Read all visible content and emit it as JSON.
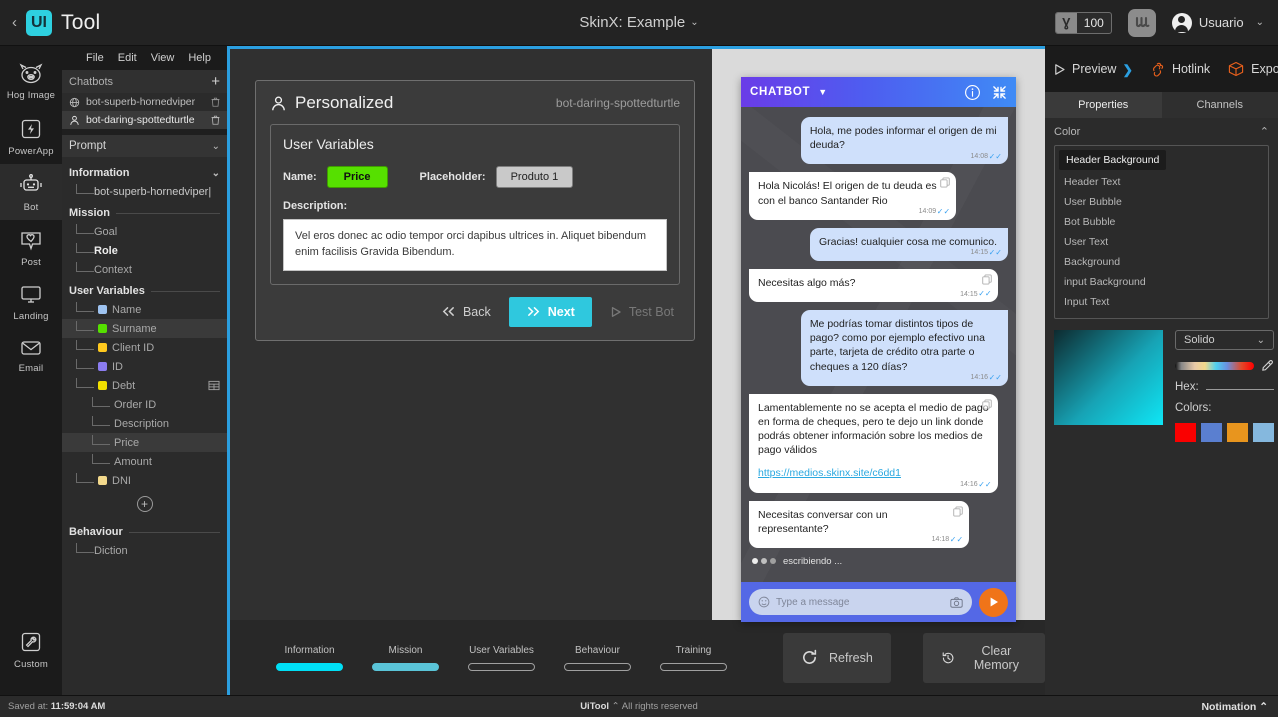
{
  "topbar": {
    "back_icon": "chevron-left-icon",
    "logo_mark": "UI",
    "logo_text": "Tool",
    "project_title": "SkinX: Example",
    "project_caret": "⌄",
    "coin_symbol": "Ɣ",
    "coin_value": "100",
    "grid_icon": "grid-icon",
    "user_name": "Usuario",
    "user_caret": "⌄"
  },
  "rail": {
    "items": [
      {
        "label": "Hog Image",
        "icon": "hog-icon",
        "active": false
      },
      {
        "label": "PowerApp",
        "icon": "bolt-icon",
        "active": false
      },
      {
        "label": "Bot",
        "icon": "robot-icon",
        "active": true
      },
      {
        "label": "Post",
        "icon": "heart-chat-icon",
        "active": false
      },
      {
        "label": "Landing",
        "icon": "monitor-icon",
        "active": false
      },
      {
        "label": "Email",
        "icon": "envelope-icon",
        "active": false
      }
    ],
    "bottom": {
      "label": "Custom",
      "icon": "wrench-icon"
    }
  },
  "menubar": {
    "items": [
      "File",
      "Edit",
      "View",
      "Help"
    ]
  },
  "chatbots": {
    "header": "Chatbots",
    "add_icon": "plus-icon",
    "items": [
      {
        "name": "bot-superb-hornedviper",
        "icon": "globe-icon",
        "selected": false
      },
      {
        "name": "bot-daring-spottedturtle",
        "icon": "person-icon",
        "selected": true
      }
    ]
  },
  "prompt_group": {
    "label": "Prompt",
    "caret": "⌄"
  },
  "tree": {
    "sections": [
      {
        "title": "Information",
        "caret": "⌄",
        "nodes": [
          {
            "label": "bot-superb-hornedviper|",
            "swatch": null,
            "style": "lit",
            "selected": false,
            "deep": false
          }
        ]
      },
      {
        "title": "Mission",
        "caret": "",
        "nodes": [
          {
            "label": "Goal",
            "swatch": null,
            "style": "dim",
            "selected": false,
            "deep": false
          },
          {
            "label": "Role",
            "swatch": null,
            "style": "strong",
            "selected": false,
            "deep": false
          },
          {
            "label": "Context",
            "swatch": null,
            "style": "dim",
            "selected": false,
            "deep": false
          }
        ]
      },
      {
        "title": "User Variables",
        "caret": "",
        "nodes": [
          {
            "label": "Name",
            "swatch": "#9ec3f0",
            "style": "dim",
            "selected": false,
            "deep": false
          },
          {
            "label": "Surname",
            "swatch": "#55e000",
            "style": "dim",
            "selected": true,
            "deep": false
          },
          {
            "label": "Client ID",
            "swatch": "#ffc91e",
            "style": "dim",
            "selected": false,
            "deep": false
          },
          {
            "label": "ID",
            "swatch": "#8b7cf0",
            "style": "dim",
            "selected": false,
            "deep": false
          },
          {
            "label": "Debt",
            "swatch": "#f2e000",
            "style": "dim",
            "selected": false,
            "deep": false,
            "table_icon": "table-icon"
          },
          {
            "label": "Order ID",
            "swatch": null,
            "style": "dim",
            "selected": false,
            "deep": true
          },
          {
            "label": "Description",
            "swatch": null,
            "style": "dim",
            "selected": false,
            "deep": true
          },
          {
            "label": "Price",
            "swatch": null,
            "style": "dim",
            "selected": true,
            "deep": true
          },
          {
            "label": "Amount",
            "swatch": null,
            "style": "dim",
            "selected": false,
            "deep": true
          },
          {
            "label": "DNI",
            "swatch": "#f3d98c",
            "style": "dim",
            "selected": false,
            "deep": false
          }
        ],
        "add_icon": "circle-plus-icon"
      },
      {
        "title": "Behaviour",
        "caret": "",
        "nodes": [
          {
            "label": "Diction",
            "swatch": null,
            "style": "dim",
            "selected": false,
            "deep": false
          }
        ]
      }
    ]
  },
  "modal": {
    "title": "Personalized",
    "title_icon": "person-icon",
    "bot_name": "bot-daring-spottedturtle",
    "card_title": "User Variables",
    "name_label": "Name:",
    "name_value": "Price",
    "name_color": "#56e000",
    "placeholder_label": "Placeholder:",
    "placeholder_value": "Produto 1",
    "description_label": "Description:",
    "description_value": "Vel eros donec ac odio tempor orci dapibus ultrices in. Aliquet bibendum enim facilisis Gravida Bibendum.",
    "back_label": "Back",
    "back_icon": "double-chevron-left-icon",
    "next_label": "Next",
    "next_icon": "double-chevron-right-icon",
    "testbot_label": "Test Bot",
    "testbot_icon": "play-icon"
  },
  "preview": {
    "header_title": "CHATBOT",
    "header_caret": "▼",
    "info_icon": "info-icon",
    "collapse_icon": "collapse-icon",
    "messages": [
      {
        "from": "user",
        "text": "Hola, me podes informar el origen de mi deuda?",
        "time": "14:08",
        "ticks": "✓✓"
      },
      {
        "from": "bot",
        "text": "Hola Nicolás! El origen de tu deuda es con el banco Santander Rio",
        "time": "14:09",
        "ticks": "✓✓",
        "copy_icon": "copy-icon"
      },
      {
        "from": "user",
        "text": "Gracias! cualquier cosa me comunico.",
        "time": "14:15",
        "ticks": "✓✓"
      },
      {
        "from": "bot",
        "text": "Necesitas algo más?",
        "time": "14:15",
        "ticks": "✓✓",
        "copy_icon": "copy-icon"
      },
      {
        "from": "user",
        "text": "Me podrías tomar distintos tipos de pago? como por ejemplo efectivo una parte, tarjeta de crédito otra parte o cheques a 120 días?",
        "time": "14:16",
        "ticks": "✓✓"
      },
      {
        "from": "bot",
        "text": "Lamentablemente no se acepta el medio de pago en forma de cheques, pero te dejo un link donde podrás obtener información sobre los medios de pago válidos",
        "link": "https://medios.skinx.site/c6dd1",
        "time": "14:16",
        "ticks": "✓✓",
        "copy_icon": "copy-icon"
      },
      {
        "from": "bot",
        "text": "Necesitas conversar con un representante?",
        "time": "14:18",
        "ticks": "✓✓",
        "copy_icon": "copy-icon"
      }
    ],
    "typing_text": "escribiendo ...",
    "input_placeholder": "Type a message",
    "emoji_icon": "emoji-icon",
    "camera_icon": "camera-icon",
    "send_icon": "send-icon"
  },
  "footer": {
    "steps": [
      {
        "label": "Information",
        "fill": 100,
        "color": "#00dff5"
      },
      {
        "label": "Mission",
        "fill": 100,
        "color": "#5ac4d8"
      },
      {
        "label": "User Variables",
        "fill": 0,
        "color": "#00dff5"
      },
      {
        "label": "Behaviour",
        "fill": 0,
        "color": "#00dff5"
      },
      {
        "label": "Training",
        "fill": 0,
        "color": "#00dff5"
      }
    ],
    "refresh_label": "Refresh",
    "refresh_icon": "refresh-icon",
    "clear_label": "Clear Memory",
    "clear_icon": "history-icon"
  },
  "rightpanel": {
    "toolbar": [
      {
        "label": "Preview",
        "icon": "play-outline-icon",
        "suffix": "❯"
      },
      {
        "label": "Hotlink",
        "icon": "hotlink-icon",
        "suffix": ""
      },
      {
        "label": "Expose",
        "icon": "box-icon",
        "suffix": ""
      }
    ],
    "tabs": [
      {
        "label": "Properties",
        "active": true
      },
      {
        "label": "Channels",
        "active": false
      }
    ],
    "section_title": "Color",
    "section_caret": "⌃",
    "color_targets": [
      {
        "label": "Header Background",
        "selected": true
      },
      {
        "label": "Header Text",
        "selected": false
      },
      {
        "label": "User Bubble",
        "selected": false
      },
      {
        "label": "Bot Bubble",
        "selected": false
      },
      {
        "label": "User Text",
        "selected": false
      },
      {
        "label": "Background",
        "selected": false
      },
      {
        "label": "input Background",
        "selected": false
      },
      {
        "label": "Input Text",
        "selected": false
      }
    ],
    "mode_label": "Solido",
    "mode_caret": "⌄",
    "eyedropper_icon": "eyedropper-icon",
    "hex_label": "Hex:",
    "hex_value": "",
    "colors_label": "Colors:",
    "swatches": [
      "#fa0000",
      "#5a7fd0",
      "#e8951e",
      "#85b8de"
    ]
  },
  "statusbar": {
    "saved_prefix": "Saved at: ",
    "saved_time": "11:59:04 AM",
    "brand": "UiTool",
    "brand_caret": "⌃",
    "rights": "All rights reserved",
    "notification": "Notimation",
    "notification_caret": "⌃"
  }
}
